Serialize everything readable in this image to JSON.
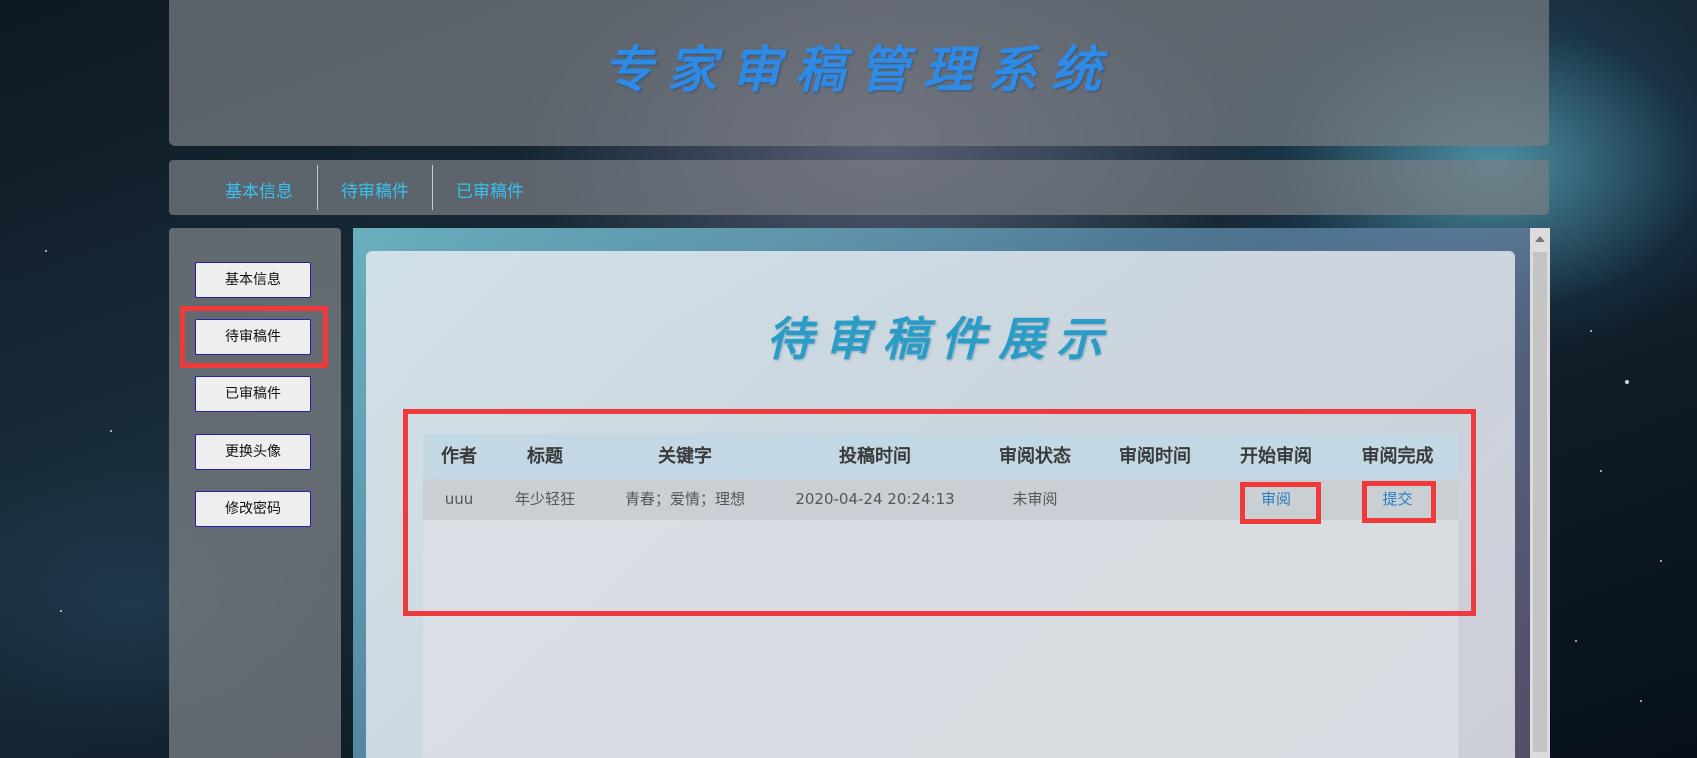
{
  "header": {
    "title": "专家审稿管理系统"
  },
  "topnav": {
    "items": [
      {
        "label": "基本信息"
      },
      {
        "label": "待审稿件"
      },
      {
        "label": "已审稿件"
      }
    ]
  },
  "sidebar": {
    "buttons": [
      {
        "label": "基本信息"
      },
      {
        "label": "待审稿件"
      },
      {
        "label": "已审稿件"
      },
      {
        "label": "更换头像"
      },
      {
        "label": "修改密码"
      }
    ]
  },
  "main": {
    "title": "待审稿件展示",
    "table": {
      "headers": [
        "作者",
        "标题",
        "关键字",
        "投稿时间",
        "审阅状态",
        "审阅时间",
        "开始审阅",
        "审阅完成"
      ],
      "rows": [
        {
          "author": "uuu",
          "title": "年少轻狂",
          "keywords": "青春；爱情；理想",
          "submitted": "2020-04-24 20:24:13",
          "status": "未审阅",
          "review_time": "",
          "start_action": "审阅",
          "finish_action": "提交"
        }
      ]
    }
  },
  "colors": {
    "highlight": "#f0393a",
    "nav_link": "#39c2f0",
    "title": "#2f8ae6",
    "panel_title": "#2b9cc6",
    "action_link": "#2a7ec4"
  }
}
